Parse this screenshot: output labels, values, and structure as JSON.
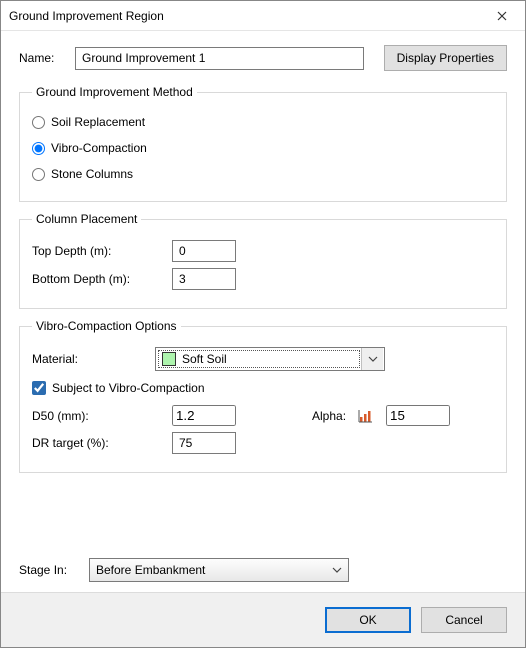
{
  "window": {
    "title": "Ground Improvement Region"
  },
  "name_row": {
    "label": "Name:",
    "value": "Ground Improvement 1",
    "display_props_label": "Display Properties"
  },
  "method_group": {
    "legend": "Ground Improvement Method",
    "options": {
      "soil_replacement": "Soil Replacement",
      "vibro_compaction": "Vibro-Compaction",
      "stone_columns": "Stone Columns"
    },
    "selected": "vibro_compaction"
  },
  "placement_group": {
    "legend": "Column Placement",
    "top_depth_label": "Top Depth (m):",
    "top_depth_value": "0",
    "bottom_depth_label": "Bottom Depth (m):",
    "bottom_depth_value": "3"
  },
  "vibro_group": {
    "legend": "Vibro-Compaction Options",
    "material_label": "Material:",
    "material_value": "Soft Soil",
    "subject_label": "Subject to Vibro-Compaction",
    "subject_checked": true,
    "d50_label": "D50 (mm):",
    "d50_value": "1.2",
    "alpha_label": "Alpha:",
    "alpha_value": "15",
    "dr_label": "DR target (%):",
    "dr_value": "75"
  },
  "stage": {
    "label": "Stage In:",
    "value": "Before Embankment"
  },
  "footer": {
    "ok": "OK",
    "cancel": "Cancel"
  }
}
